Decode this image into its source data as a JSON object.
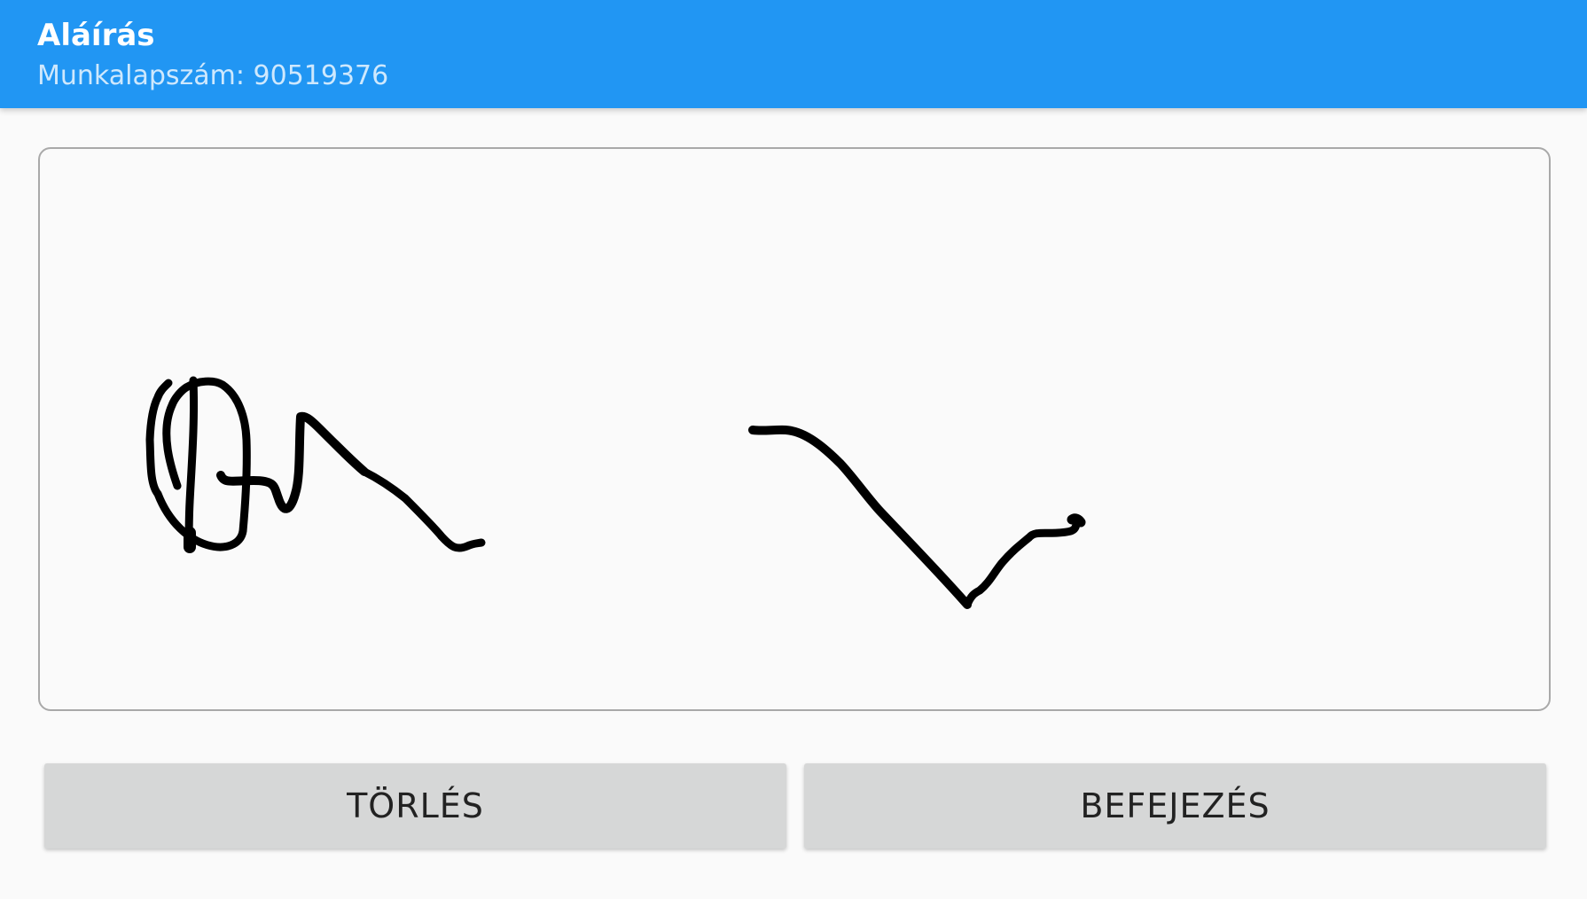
{
  "header": {
    "title": "Aláírás",
    "subtitle": "Munkalapszám: 90519376"
  },
  "buttons": {
    "clear_label": "TÖRLÉS",
    "finish_label": "BEFEJEZÉS"
  },
  "colors": {
    "appbar": "#2196f3",
    "background": "#fafafa",
    "button": "#d6d7d7",
    "ink": "#000000"
  }
}
